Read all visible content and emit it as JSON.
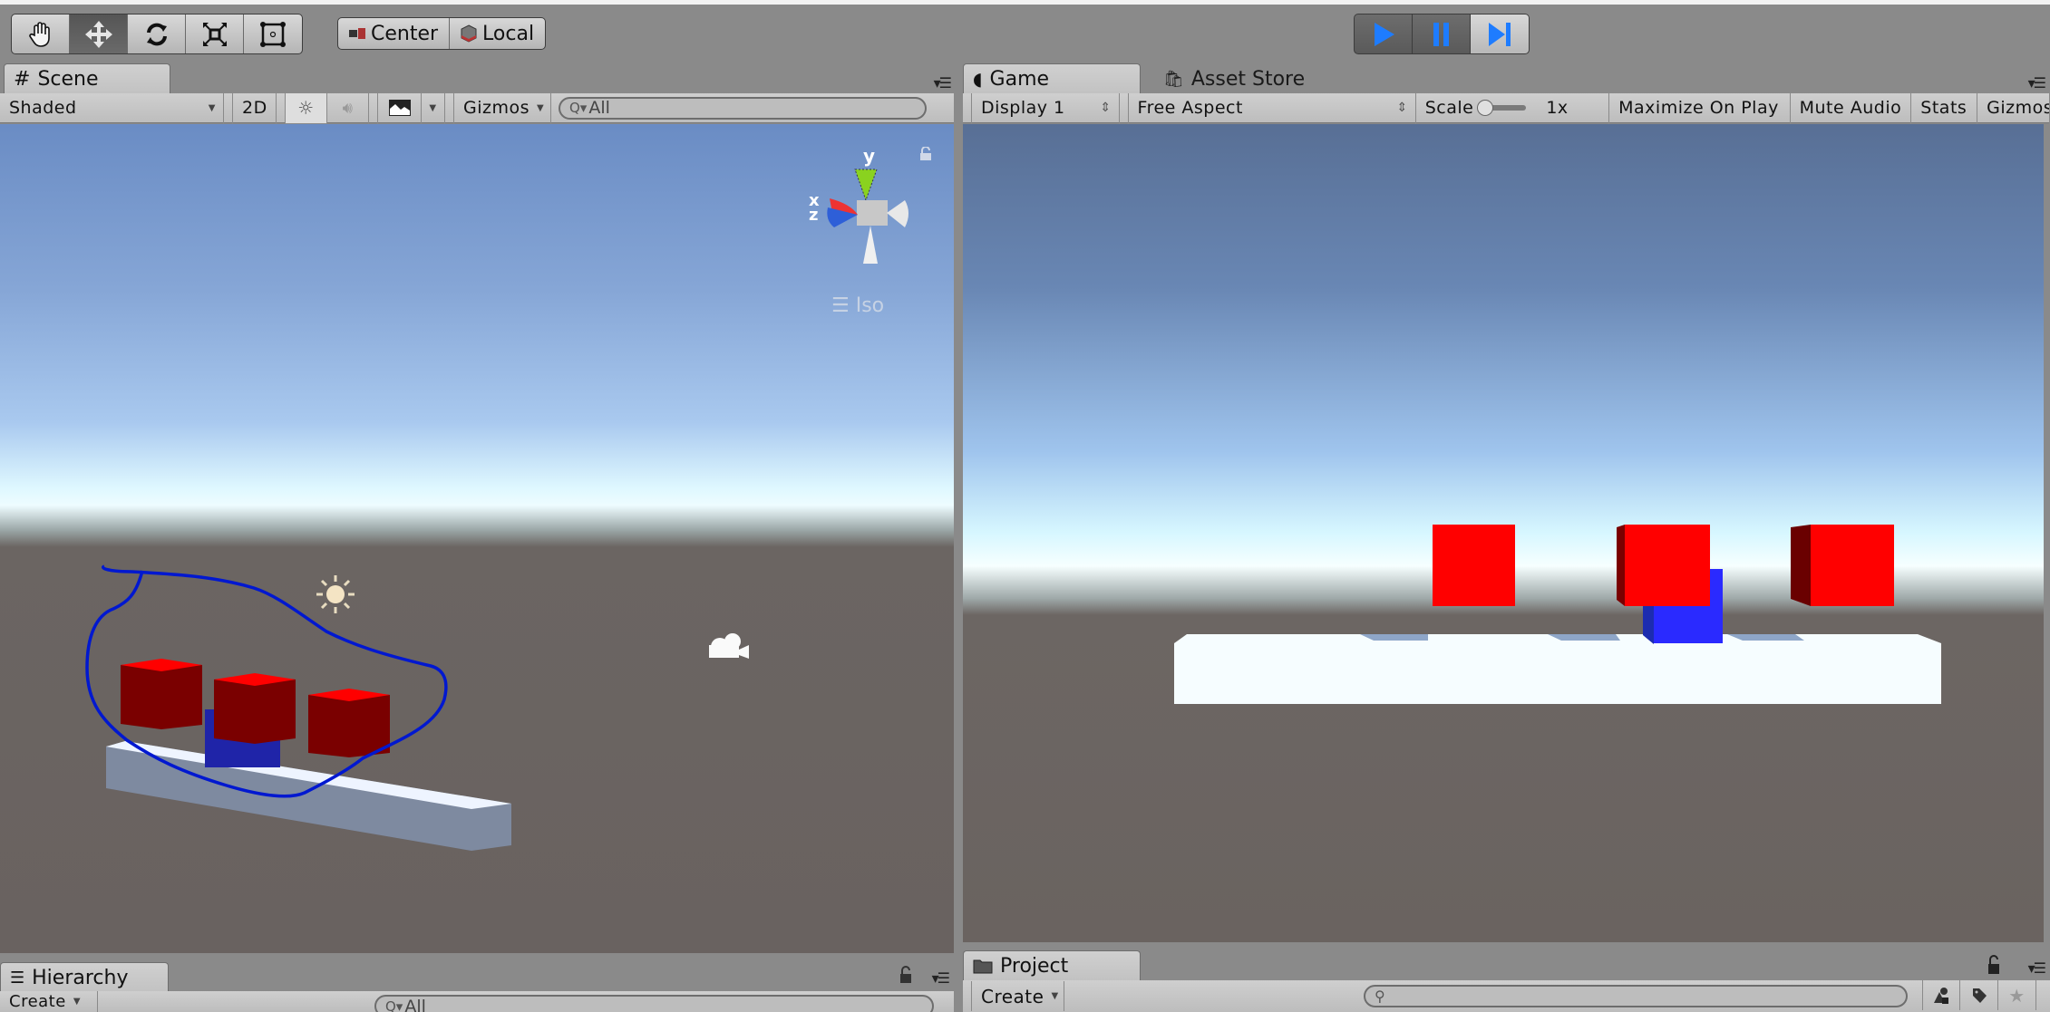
{
  "toolbar": {
    "tools": [
      {
        "name": "hand-tool",
        "icon": "hand-icon",
        "active": false
      },
      {
        "name": "move-tool",
        "icon": "move-arrows-icon",
        "active": true
      },
      {
        "name": "rotate-tool",
        "icon": "rotate-icon",
        "active": false
      },
      {
        "name": "scale-tool",
        "icon": "scale-icon",
        "active": false
      },
      {
        "name": "rect-tool",
        "icon": "rect-transform-icon",
        "active": false
      }
    ],
    "pivot_label": "Center",
    "space_label": "Local",
    "play_controls": {
      "play": "play-icon",
      "pause": "pause-icon",
      "step": "step-icon"
    }
  },
  "scene": {
    "tab_label": "Scene",
    "shading_mode": "Shaded",
    "mode_2d": "2D",
    "gizmos_label": "Gizmos",
    "search_placeholder": "All",
    "projection_label": "Iso",
    "axis_labels": {
      "x": "x",
      "y": "y",
      "z": "z"
    }
  },
  "game": {
    "tab_label": "Game",
    "asset_store_tab": "Asset Store",
    "display": "Display 1",
    "aspect": "Free Aspect",
    "scale_label": "Scale",
    "scale_value": "1x",
    "maximize_on_play": "Maximize On Play",
    "mute_audio": "Mute Audio",
    "stats": "Stats",
    "gizmos_label": "Gizmos"
  },
  "hierarchy": {
    "tab_label": "Hierarchy",
    "create_label": "Create",
    "search_placeholder": "All"
  },
  "project": {
    "tab_label": "Project",
    "create_label": "Create",
    "search_placeholder": ""
  },
  "colors": {
    "cube_red": "#ff0000",
    "cube_red_dark": "#7a0000",
    "cube_blue": "#2a2aff",
    "annotation_stroke": "#0018d0",
    "play_accent": "#1e7cff"
  }
}
